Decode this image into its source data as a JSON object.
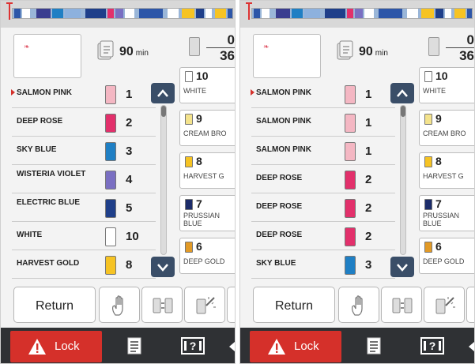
{
  "panels": [
    {
      "id": "left",
      "time": {
        "value": "90",
        "unit": "min"
      },
      "counter": {
        "current": "0",
        "total": "36"
      },
      "colors": [
        {
          "name": "SALMON PINK",
          "num": "1",
          "color": "#f4b7c3",
          "current": true
        },
        {
          "name": "DEEP ROSE",
          "num": "2",
          "color": "#e2306b",
          "current": false
        },
        {
          "name": "SKY BLUE",
          "num": "3",
          "color": "#1f7fc4",
          "current": false
        },
        {
          "name": "WISTERIA VIOLET",
          "num": "4",
          "color": "#7a6fc2",
          "current": false
        },
        {
          "name": "ELECTRIC BLUE",
          "num": "5",
          "color": "#1f3f8a",
          "current": false
        },
        {
          "name": "WHITE",
          "num": "10",
          "color": "#ffffff",
          "current": false
        },
        {
          "name": "HARVEST GOLD",
          "num": "8",
          "color": "#f6c323",
          "current": false
        }
      ],
      "threads": [
        {
          "num": "10",
          "name": "WHITE",
          "color": "#ffffff"
        },
        {
          "num": "9",
          "name": "CREAM BRO",
          "color": "#f4e38c"
        },
        {
          "num": "8",
          "name": "HARVEST G",
          "color": "#f6c323"
        },
        {
          "num": "7",
          "name": "PRUSSIAN BLUE",
          "color": "#1c2c6a"
        },
        {
          "num": "6",
          "name": "DEEP GOLD",
          "color": "#e29a26"
        }
      ]
    },
    {
      "id": "right",
      "time": {
        "value": "90",
        "unit": "min"
      },
      "counter": {
        "current": "0",
        "total": "36"
      },
      "colors": [
        {
          "name": "SALMON PINK",
          "num": "1",
          "color": "#f4b7c3",
          "current": true
        },
        {
          "name": "SALMON PINK",
          "num": "1",
          "color": "#f4b7c3",
          "current": false
        },
        {
          "name": "SALMON PINK",
          "num": "1",
          "color": "#f4b7c3",
          "current": false
        },
        {
          "name": "DEEP ROSE",
          "num": "2",
          "color": "#e2306b",
          "current": false
        },
        {
          "name": "DEEP ROSE",
          "num": "2",
          "color": "#e2306b",
          "current": false
        },
        {
          "name": "DEEP ROSE",
          "num": "2",
          "color": "#e2306b",
          "current": false
        },
        {
          "name": "SKY BLUE",
          "num": "3",
          "color": "#1f7fc4",
          "current": false
        }
      ],
      "threads": [
        {
          "num": "10",
          "name": "WHITE",
          "color": "#ffffff"
        },
        {
          "num": "9",
          "name": "CREAM BRO",
          "color": "#f4e38c"
        },
        {
          "num": "8",
          "name": "HARVEST G",
          "color": "#f6c323"
        },
        {
          "num": "7",
          "name": "PRUSSIAN BLUE",
          "color": "#1c2c6a"
        },
        {
          "num": "6",
          "name": "DEEP GOLD",
          "color": "#e29a26"
        }
      ]
    }
  ],
  "buttons": {
    "return_label": "Return",
    "lock_label": "Lock"
  },
  "colors": {
    "accent_red": "#d5302a",
    "scroll_button": "#3a4e68",
    "footer_bg": "#2f3134"
  },
  "icons": {
    "hand": "hand-icon",
    "swap": "swap-spools-icon",
    "magic": "magic-wand-icon",
    "warning": "warning-icon",
    "document": "document-icon",
    "help": "help-icon"
  }
}
